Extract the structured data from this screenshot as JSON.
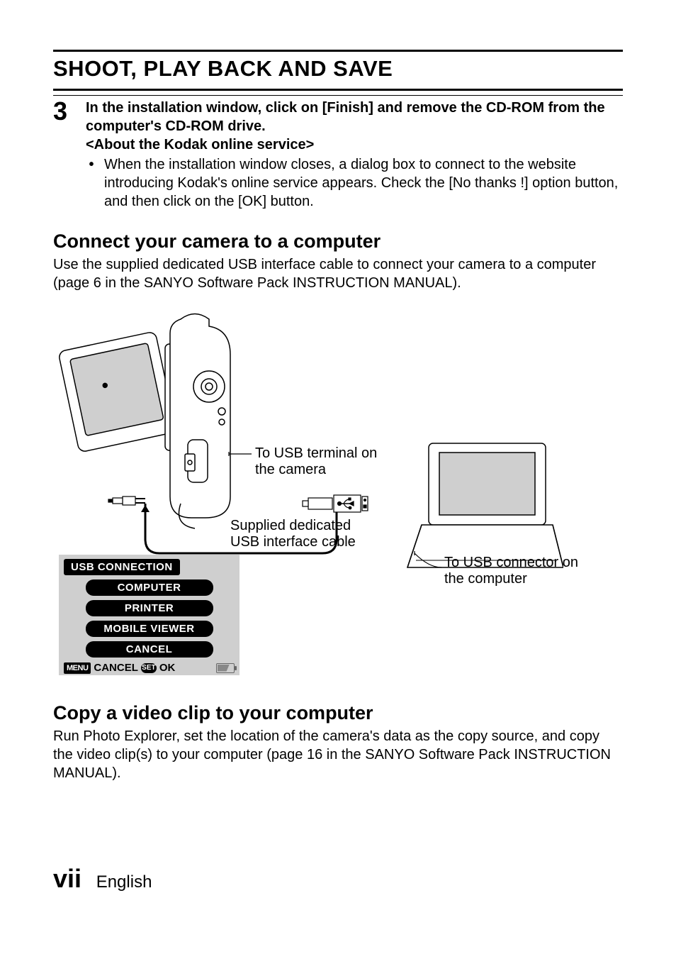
{
  "header": {
    "title": "SHOOT, PLAY BACK AND SAVE"
  },
  "step": {
    "number": "3",
    "line1": "In the installation window, click on [Finish] and remove the CD-ROM from the computer's CD-ROM drive.",
    "line2": "<About the Kodak online service>",
    "bullet": "When the installation window closes, a dialog box to connect to the website introducing Kodak's online service appears. Check the [No thanks !] option button, and then click on the [OK] button."
  },
  "section1": {
    "heading": "Connect your camera to a computer",
    "para": "Use the supplied dedicated USB interface cable to connect your camera to a computer (page 6 in the SANYO Software Pack INSTRUCTION MANUAL)."
  },
  "diagram": {
    "label_usb_cam": "To USB terminal on the camera",
    "label_cable": "Supplied dedicated USB interface cable",
    "label_usb_pc": "To USB connector on the computer"
  },
  "menu": {
    "header": "USB CONNECTION",
    "items": [
      "COMPUTER",
      "PRINTER",
      "MOBILE VIEWER",
      "CANCEL"
    ],
    "footer_menu": "MENU",
    "footer_cancel": "CANCEL",
    "footer_set": "SET",
    "footer_ok": "OK"
  },
  "section2": {
    "heading": "Copy a video clip to your computer",
    "para": "Run Photo Explorer, set the location of the camera's data as the copy source, and copy the video clip(s) to your computer (page 16 in the SANYO Software Pack INSTRUCTION MANUAL)."
  },
  "footer": {
    "page": "vii",
    "lang": "English"
  }
}
